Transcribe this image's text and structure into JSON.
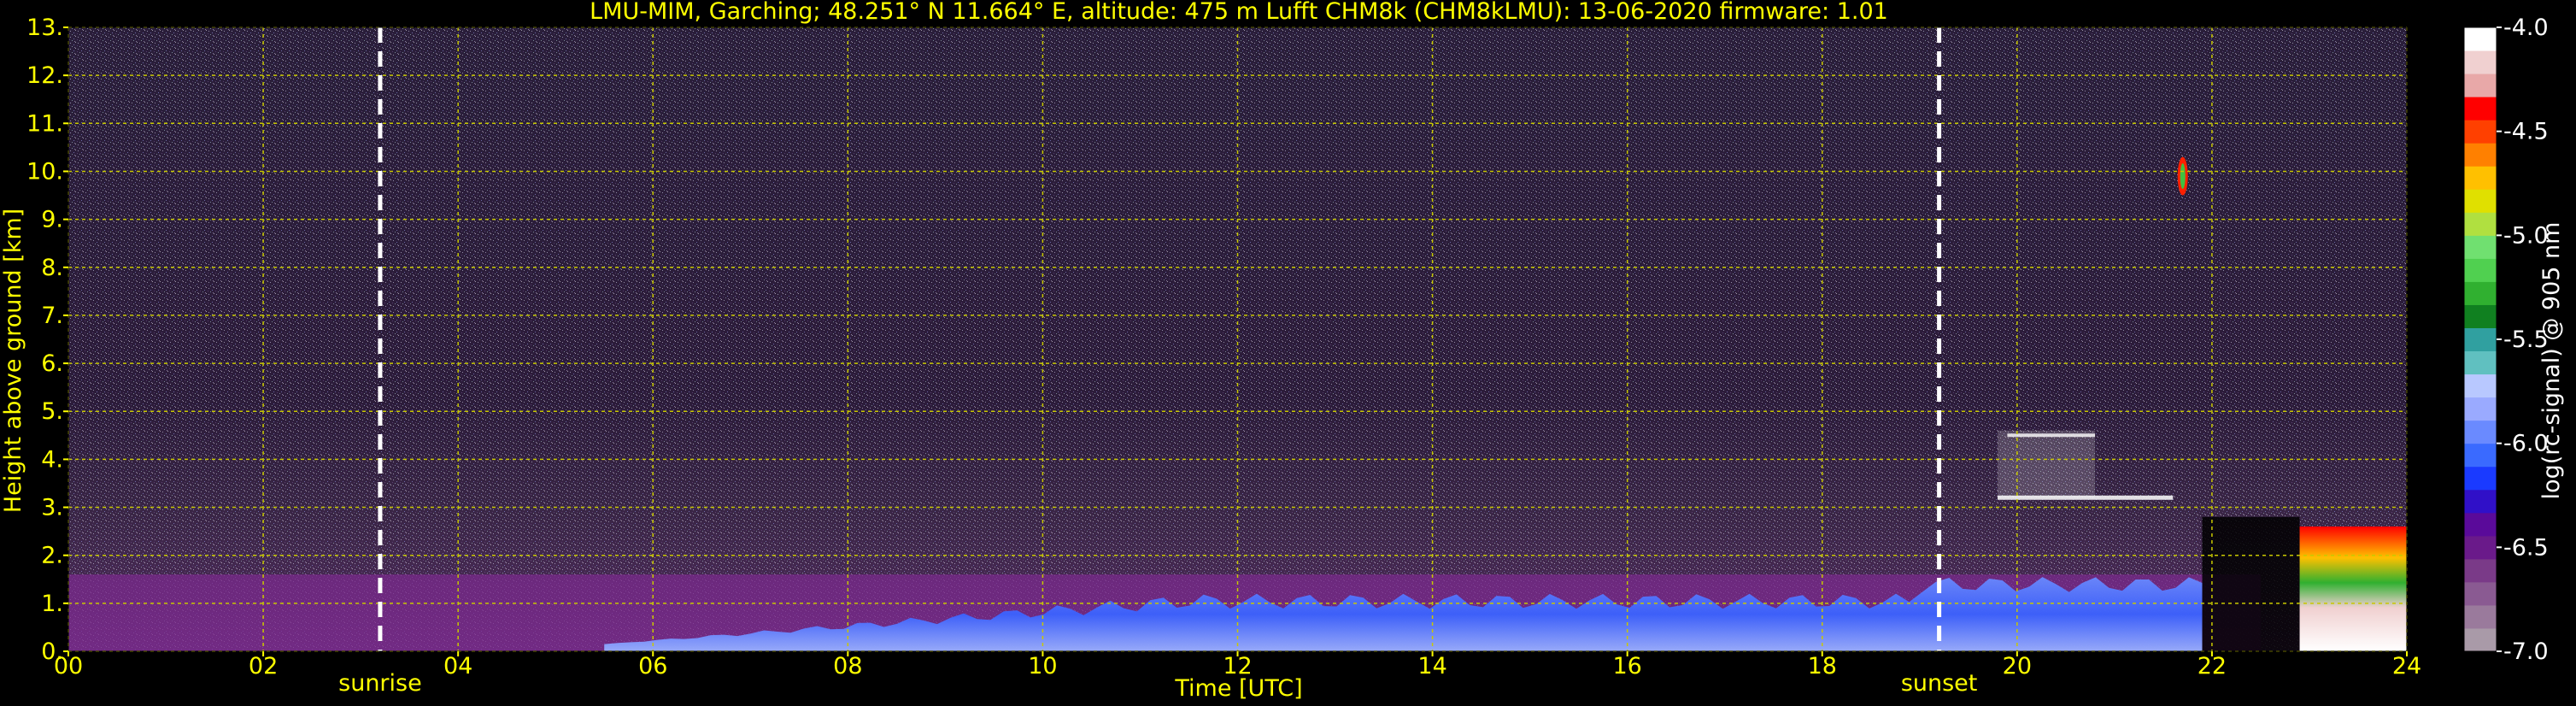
{
  "chart_data": {
    "type": "heatmap",
    "title": "LMU-MIM, Garching; 48.251° N 11.664° E, altitude: 475 m    Lufft CHM8k (CHM8kLMU): 13-06-2020    firmware: 1.01",
    "xlabel": "Time [UTC]",
    "ylabel": "Height above ground [km]",
    "xlim": [
      0,
      24
    ],
    "ylim": [
      0,
      13
    ],
    "x_ticks": [
      "00",
      "02",
      "04",
      "06",
      "08",
      "10",
      "12",
      "14",
      "16",
      "18",
      "20",
      "22",
      "24"
    ],
    "y_ticks": [
      "0.",
      "1.",
      "2.",
      "3.",
      "4.",
      "5.",
      "6.",
      "7.",
      "8.",
      "9.",
      "10.",
      "11.",
      "12.",
      "13."
    ],
    "grid": true,
    "markers": [
      {
        "label": "sunrise",
        "time": 3.2
      },
      {
        "label": "sunset",
        "time": 19.2
      }
    ],
    "colorbar": {
      "label": "log(rc-signal) @ 905 nm",
      "ticks": [
        "-4.0",
        "-4.5",
        "-5.0",
        "-5.5",
        "-6.0",
        "-6.5",
        "-7.0"
      ],
      "range": [
        -7.0,
        -4.0
      ],
      "colors": [
        "#a99aa8",
        "#9a7a9c",
        "#8a5a92",
        "#7a3a88",
        "#6a1a8a",
        "#5a0a9a",
        "#3010c8",
        "#1a3aff",
        "#3a6aff",
        "#6a8aff",
        "#9aaaff",
        "#b8c8ff",
        "#60c0c0",
        "#30a0a0",
        "#108020",
        "#30b030",
        "#50d050",
        "#70e070",
        "#b0e040",
        "#e0e000",
        "#ffc000",
        "#ff8000",
        "#ff4000",
        "#ff0000",
        "#e8a8a8",
        "#f0d0d0",
        "#ffffff"
      ]
    },
    "features": [
      {
        "name": "boundary layer aerosol",
        "time_start": 0.0,
        "time_end": 22.5,
        "height_top_km": 1.6,
        "log_signal": -6.4
      },
      {
        "name": "mixed layer backscatter",
        "time_start": 5.5,
        "time_end": 21.9,
        "height_top_km": 1.2,
        "log_signal": -6.0
      },
      {
        "name": "elevated layer",
        "time_start": 19.8,
        "time_end": 20.8,
        "height_base_km": 3.2,
        "height_top_km": 4.6,
        "log_signal": -5.5
      },
      {
        "name": "cirrus",
        "time_start": 21.65,
        "time_end": 21.75,
        "height_base_km": 9.5,
        "height_top_km": 10.3,
        "log_signal": -5.0
      },
      {
        "name": "low cloud",
        "time_start": 22.9,
        "time_end": 24.0,
        "height_base_km": 0.0,
        "height_top_km": 2.6,
        "log_signal": -4.2
      }
    ]
  },
  "colors": {
    "text": "#ffff00",
    "colorbar_label": "#ffffff",
    "grid": "#c8c800",
    "marker": "#ffffff",
    "background": "#000000"
  }
}
